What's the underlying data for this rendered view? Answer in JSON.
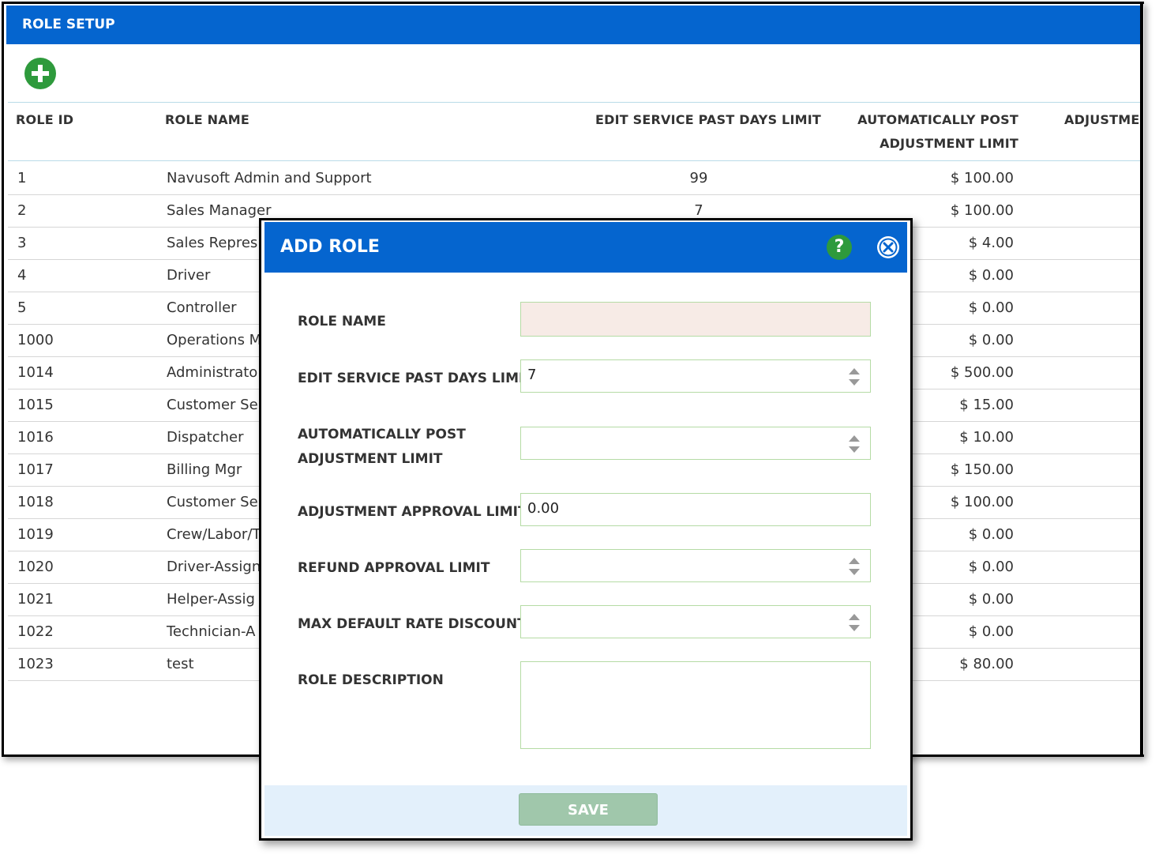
{
  "header": {
    "title": "ROLE SETUP"
  },
  "columns": {
    "role_id": "ROLE ID",
    "role_name": "ROLE NAME",
    "edit_days_limit": "EDIT SERVICE PAST DAYS LIMIT",
    "auto_post_line1": "AUTOMATICALLY POST",
    "auto_post_line2": "ADJUSTMENT LIMIT",
    "adjustment": "ADJUSTME"
  },
  "rows": [
    {
      "id": "1",
      "name": "Navusoft Admin and Support",
      "days": "99",
      "post": "$ 100.00"
    },
    {
      "id": "2",
      "name": "Sales Manager",
      "days": "7",
      "post": "$ 100.00"
    },
    {
      "id": "3",
      "name": "Sales Repres",
      "days": "",
      "post": "$ 4.00"
    },
    {
      "id": "4",
      "name": "Driver",
      "days": "",
      "post": "$ 0.00"
    },
    {
      "id": "5",
      "name": "Controller",
      "days": "",
      "post": "$ 0.00"
    },
    {
      "id": "1000",
      "name": "Operations M",
      "days": "",
      "post": "$ 0.00"
    },
    {
      "id": "1014",
      "name": "Administrato",
      "days": "",
      "post": "$ 500.00"
    },
    {
      "id": "1015",
      "name": "Customer Se",
      "days": "",
      "post": "$ 15.00"
    },
    {
      "id": "1016",
      "name": "Dispatcher",
      "days": "",
      "post": "$ 10.00"
    },
    {
      "id": "1017",
      "name": "Billing Mgr",
      "days": "",
      "post": "$ 150.00"
    },
    {
      "id": "1018",
      "name": "Customer Se",
      "days": "",
      "post": "$ 100.00"
    },
    {
      "id": "1019",
      "name": "Crew/Labor/T",
      "days": "",
      "post": "$ 0.00"
    },
    {
      "id": "1020",
      "name": "Driver-Assign",
      "days": "",
      "post": "$ 0.00"
    },
    {
      "id": "1021",
      "name": "Helper-Assig",
      "days": "",
      "post": "$ 0.00"
    },
    {
      "id": "1022",
      "name": "Technician-A",
      "days": "",
      "post": "$ 0.00"
    },
    {
      "id": "1023",
      "name": "test",
      "days": "",
      "post": "$ 80.00"
    }
  ],
  "modal": {
    "title": "ADD ROLE",
    "help_glyph": "?",
    "fields": {
      "role_name": {
        "label": "ROLE NAME",
        "value": ""
      },
      "edit_days": {
        "label": "EDIT SERVICE PAST DAYS LIMIT",
        "value": "7"
      },
      "auto_post_line1": "AUTOMATICALLY POST",
      "auto_post_line2": "ADJUSTMENT LIMIT",
      "auto_post_value": "",
      "adj_approval": {
        "label": "ADJUSTMENT APPROVAL LIMIT",
        "value": "0.00"
      },
      "refund_approval": {
        "label": "REFUND APPROVAL LIMIT",
        "value": ""
      },
      "max_discount": {
        "label": "MAX DEFAULT RATE DISCOUNT",
        "value": ""
      },
      "description": {
        "label": "ROLE DESCRIPTION",
        "value": ""
      }
    },
    "save_label": "SAVE"
  },
  "colors": {
    "header_blue": "#0565cf",
    "add_green": "#2e9a3c",
    "save_disabled": "#a0c7ab"
  }
}
